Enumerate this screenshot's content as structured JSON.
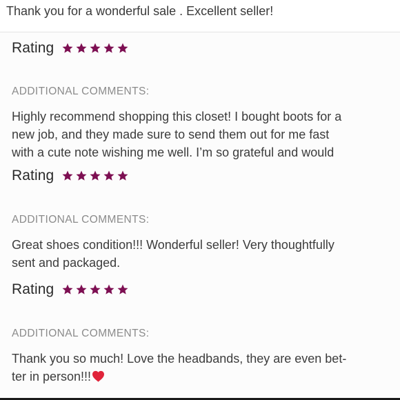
{
  "top_comment": "Thank you for a wonderful sale . Excellent seller!",
  "reviews": [
    {
      "rating_label": "Rating",
      "stars": 5,
      "heading": "ADDITIONAL COMMENTS:",
      "comment_lines": [
        "Highly recommend shopping this closet! I bought boots for a",
        "new job, and they made sure to send them out for me fast",
        "with a cute note wishing me well. I’m so grateful and would"
      ]
    },
    {
      "rating_label": "Rating",
      "stars": 5,
      "heading": "ADDITIONAL COMMENTS:",
      "comment_lines": [
        "Great shoes condition!!! Wonderful seller! Very thoughtfully",
        "sent and packaged."
      ]
    },
    {
      "rating_label": "Rating",
      "stars": 5,
      "heading": "ADDITIONAL COMMENTS:",
      "comment_lines": [
        "Thank you so much! Love the headbands, they are even bet-",
        "ter in person!!!"
      ],
      "trailing_emoji": "heart-icon"
    }
  ],
  "first_rating": {
    "rating_label": "Rating",
    "stars": 5
  },
  "colors": {
    "star": "#7d0f52",
    "heart": "#e0243a",
    "heading": "#8b8b8b",
    "text": "#3c3c3c"
  }
}
